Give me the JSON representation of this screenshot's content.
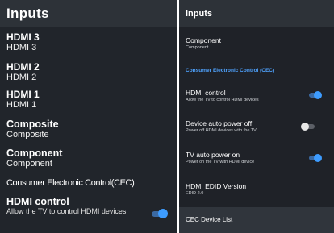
{
  "left": {
    "title": "Inputs",
    "items": [
      {
        "title": "HDMI 3",
        "subtitle": "HDMI 3"
      },
      {
        "title": "HDMI 2",
        "subtitle": "HDMI 2"
      },
      {
        "title": "HDMI 1",
        "subtitle": "HDMI 1"
      },
      {
        "title": "Composite",
        "subtitle": "Composite"
      },
      {
        "title": "Component",
        "subtitle": "Component"
      }
    ],
    "cec_label": "Consumer Electronic Control(CEC)",
    "hdmi_control": {
      "title": "HDMI control",
      "subtitle": "Allow the TV to control HDMI devices",
      "toggle_on": true
    }
  },
  "right": {
    "title": "Inputs",
    "component": {
      "title": "Component",
      "subtitle": "Component"
    },
    "section_label": "Consumer Electronic Control (CEC)",
    "hdmi_control": {
      "title": "HDMI control",
      "subtitle": "Allow the TV to control HDMI devices",
      "toggle_on": true
    },
    "device_auto_power_off": {
      "title": "Device auto power off",
      "subtitle": "Power off HDMI devices with the TV",
      "toggle_on": false
    },
    "tv_auto_power_on": {
      "title": "TV auto power on",
      "subtitle": "Power on the TV with HDMI device",
      "toggle_on": true
    },
    "hdmi_edid_version": {
      "title": "HDMI EDID Version",
      "subtitle": "EDID 2.0"
    },
    "cec_device_list": {
      "title": "CEC Device List"
    }
  },
  "colors": {
    "background": "#21252b",
    "header": "#2d3238",
    "accent": "#3d9cff",
    "section_label": "#4fa3ff",
    "highlight": "#30353c"
  }
}
